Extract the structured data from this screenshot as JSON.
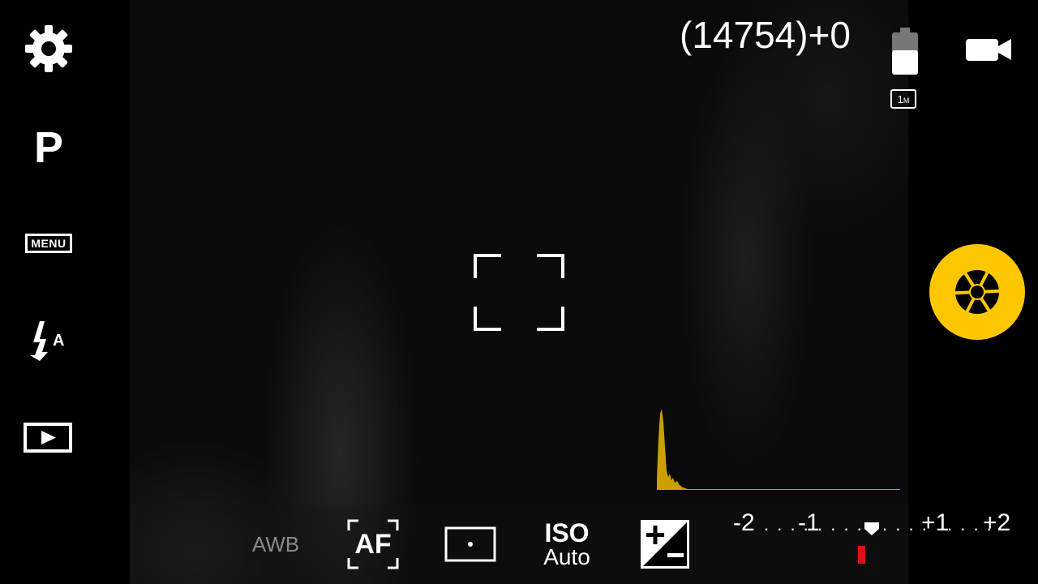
{
  "left_bar": {
    "settings_icon": "gear-icon",
    "mode": "P",
    "menu_label": "MENU",
    "flash_icon": "flash-auto-icon",
    "flash_mode": "A",
    "playback_icon": "play-icon"
  },
  "top": {
    "shot_count": "(14754)+0",
    "battery_icon": "battery-icon",
    "resolution": "1",
    "resolution_unit": "M",
    "video_icon": "video-camera-icon"
  },
  "shutter": {
    "icon": "aperture-icon",
    "color": "#fdc700"
  },
  "bottom_bar": {
    "awb": "AWB",
    "af": "AF",
    "metering_icon": "spot-metering-icon",
    "iso_label": "ISO",
    "iso_value": "Auto",
    "ev_icon": "exposure-compensation-icon",
    "ev_ticks": [
      "-2",
      "-1",
      "+1",
      "+2"
    ],
    "ev_current": 0.3
  },
  "colors": {
    "accent": "#fdc700",
    "histogram": "#c9a000",
    "ev_marker": "#e01010"
  }
}
